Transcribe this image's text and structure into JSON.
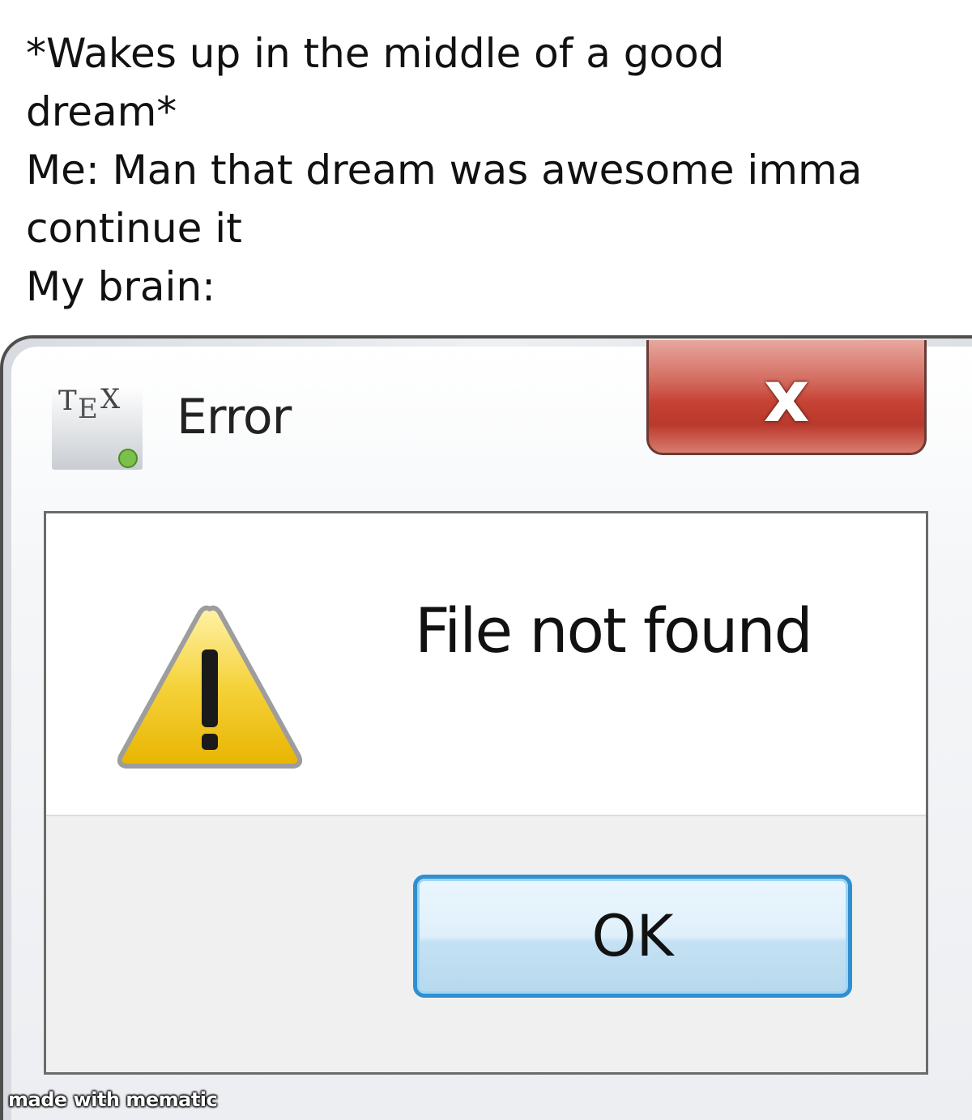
{
  "caption": {
    "text": "*Wakes up in the middle of a good\ndream*\nMe: Man that dream was awesome imma\ncontinue it\nMy brain:"
  },
  "dialog": {
    "app_icon": "tex-icon",
    "title": "Error",
    "close_icon": "close-icon",
    "close_glyph": "x",
    "warning_icon": "warning-icon",
    "message": "File not found",
    "ok_label": "OK",
    "colors": {
      "close_button": "#c64234",
      "ok_border": "#2f8fd0",
      "warning_fill": "#f2c61f"
    }
  },
  "watermark": "made with mematic"
}
